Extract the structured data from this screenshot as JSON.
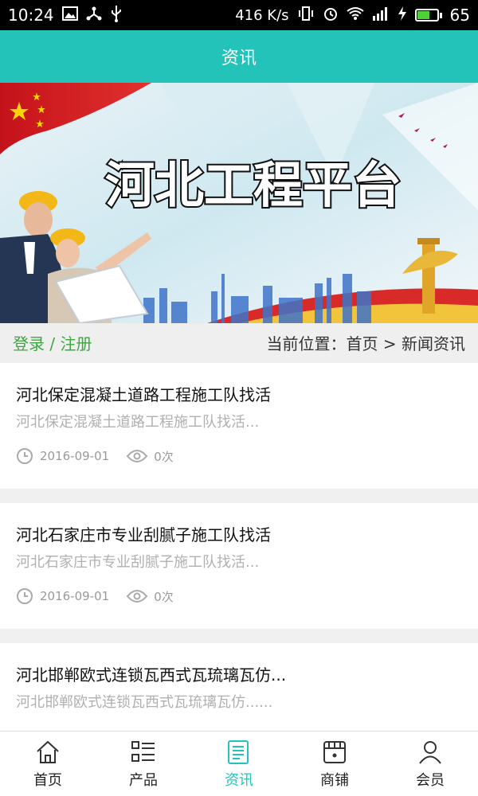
{
  "status_bar": {
    "time": "10:24",
    "speed": "416 K/s",
    "battery_level": "65"
  },
  "header": {
    "title": "资讯"
  },
  "banner": {
    "headline": "河北工程平台"
  },
  "crumbbar": {
    "login": "登录",
    "separator": " / ",
    "register": "注册",
    "location_label": "当前位置：",
    "home": "首页",
    "arrow": " > ",
    "current": "新闻资讯"
  },
  "news": [
    {
      "title": "河北保定混凝土道路工程施工队找活",
      "summary": "河北保定混凝土道路工程施工队找活...",
      "date": "2016-09-01",
      "views": "0次"
    },
    {
      "title": "河北石家庄市专业刮腻子施工队找活",
      "summary": "河北石家庄市专业刮腻子施工队找活...",
      "date": "2016-09-01",
      "views": "0次"
    },
    {
      "title": "河北邯郸欧式连锁瓦西式瓦琉璃瓦仿...",
      "summary": "河北邯郸欧式连锁瓦西式瓦琉璃瓦仿......",
      "date": "",
      "views": ""
    }
  ],
  "tabs": [
    {
      "label": "首页",
      "icon": "home-icon"
    },
    {
      "label": "产品",
      "icon": "list-icon"
    },
    {
      "label": "资讯",
      "icon": "news-icon"
    },
    {
      "label": "商铺",
      "icon": "shop-icon"
    },
    {
      "label": "会员",
      "icon": "user-icon"
    }
  ],
  "colors": {
    "accent": "#23c3b9",
    "login": "#3ea63e"
  }
}
